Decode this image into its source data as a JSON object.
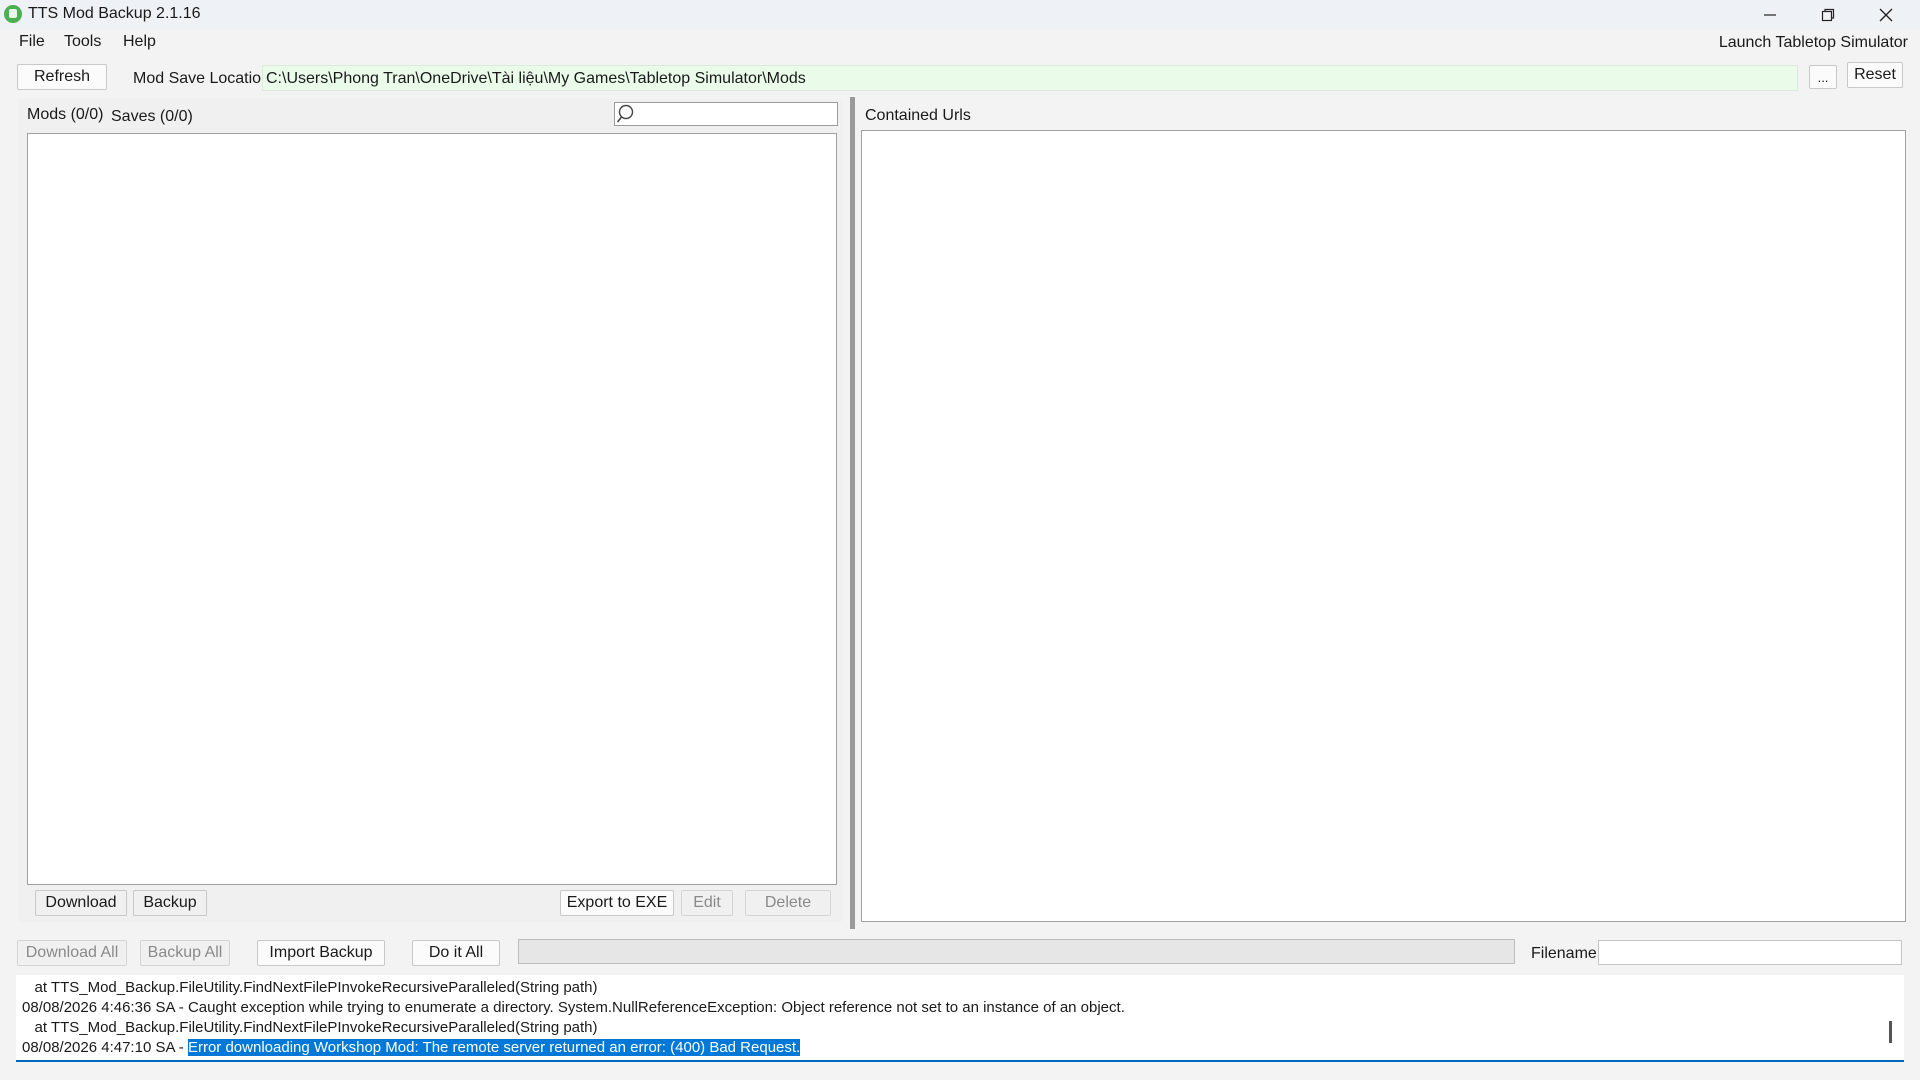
{
  "window": {
    "title": "TTS Mod Backup 2.1.16",
    "icons": [
      "app-icon",
      "minimize-icon",
      "restore-icon",
      "close-icon"
    ]
  },
  "menu": {
    "items": [
      "File",
      "Tools",
      "Help"
    ],
    "launch": "Launch Tabletop Simulator"
  },
  "toolbar": {
    "refresh": "Refresh",
    "mod_save_label": "Mod Save Location",
    "mod_save_path": "C:\\Users\\Phong Tran\\OneDrive\\Tài liệu\\My Games\\Tabletop Simulator\\Mods",
    "browse": "...",
    "reset": "Reset"
  },
  "left": {
    "tabs": [
      "Mods (0/0)",
      "Saves (0/0)"
    ],
    "search_value": "",
    "buttons": {
      "download": "Download",
      "backup": "Backup",
      "export": "Export to EXE",
      "edit": "Edit",
      "delete": "Delete"
    }
  },
  "right": {
    "label": "Contained Urls"
  },
  "bottom": {
    "download_all": "Download All",
    "backup_all": "Backup All",
    "import_backup": "Import Backup",
    "do_it_all": "Do it All",
    "progress": 0,
    "filename_label": "Filename",
    "filename_value": ""
  },
  "log": {
    "lines": [
      "   at TTS_Mod_Backup.FileUtility.FindNextFilePInvokeRecursiveParalleled(String path)",
      "08/08/2026 4:46:36 SA - Caught exception while trying to enumerate a directory. System.NullReferenceException: Object reference not set to an instance of an object.",
      "   at TTS_Mod_Backup.FileUtility.FindNextFilePInvokeRecursiveParalleled(String path)"
    ],
    "last_prefix": "08/08/2026 4:47:10 SA - ",
    "last_highlight": "Error downloading Workshop Mod: The remote server returned an error: (400) Bad Request."
  },
  "colors": {
    "accent": "#0078d7",
    "path_field_bg": "#eafbea",
    "app_icon": "#4caf50"
  }
}
